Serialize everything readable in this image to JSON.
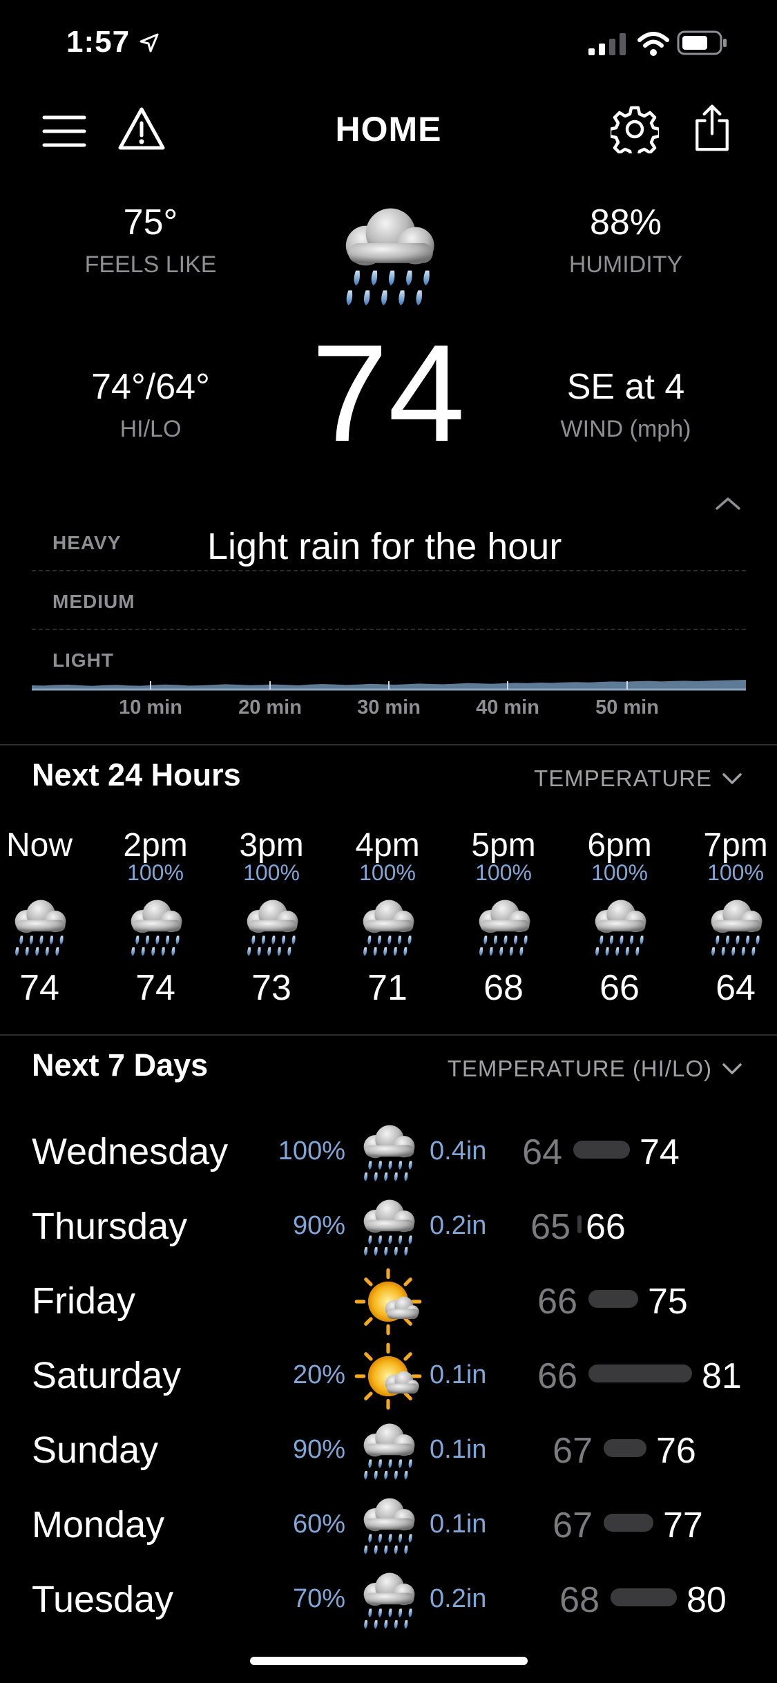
{
  "status_bar": {
    "time": "1:57"
  },
  "header": {
    "title": "HOME"
  },
  "current": {
    "feels_like_value": "75°",
    "feels_like_label": "FEELS LIKE",
    "humidity_value": "88%",
    "humidity_label": "HUMIDITY",
    "hilo_value": "74°/64°",
    "hilo_label": "HI/LO",
    "wind_value": "SE at 4",
    "wind_label": "WIND (mph)",
    "temperature": "74"
  },
  "precip": {
    "summary": "Light rain for the hour",
    "levels": [
      "HEAVY",
      "MEDIUM",
      "LIGHT"
    ],
    "ticks": [
      "10 min",
      "20 min",
      "30 min",
      "40 min",
      "50 min"
    ],
    "intensity": [
      0.3,
      0.28,
      0.33,
      0.35,
      0.3,
      0.26,
      0.31,
      0.34,
      0.29,
      0.27,
      0.32,
      0.36,
      0.33,
      0.28,
      0.3,
      0.34,
      0.38,
      0.35,
      0.31,
      0.33,
      0.37,
      0.34,
      0.3,
      0.36,
      0.4,
      0.37,
      0.33,
      0.36,
      0.41,
      0.38,
      0.35,
      0.39,
      0.43,
      0.4,
      0.38,
      0.42,
      0.46,
      0.44,
      0.41,
      0.45,
      0.48,
      0.46,
      0.5,
      0.48,
      0.52,
      0.54,
      0.51,
      0.55,
      0.58,
      0.56,
      0.6,
      0.62,
      0.58,
      0.61,
      0.63,
      0.6,
      0.64,
      0.66,
      0.68,
      0.7
    ]
  },
  "hourly": {
    "title": "Next 24 Hours",
    "selector": "TEMPERATURE",
    "items": [
      {
        "time": "Now",
        "pct": "",
        "temp": "74",
        "icon": "rain-cloud-icon"
      },
      {
        "time": "2pm",
        "pct": "100%",
        "temp": "74",
        "icon": "rain-cloud-icon"
      },
      {
        "time": "3pm",
        "pct": "100%",
        "temp": "73",
        "icon": "rain-cloud-icon"
      },
      {
        "time": "4pm",
        "pct": "100%",
        "temp": "71",
        "icon": "rain-cloud-icon"
      },
      {
        "time": "5pm",
        "pct": "100%",
        "temp": "68",
        "icon": "rain-cloud-icon"
      },
      {
        "time": "6pm",
        "pct": "100%",
        "temp": "66",
        "icon": "rain-cloud-icon"
      },
      {
        "time": "7pm",
        "pct": "100%",
        "temp": "64",
        "icon": "rain-cloud-icon"
      }
    ]
  },
  "daily": {
    "title": "Next 7 Days",
    "selector": "TEMPERATURE (HI/LO)",
    "days": [
      {
        "name": "Wednesday",
        "pct": "100%",
        "icon": "rain-cloud-icon",
        "amount": "0.4in",
        "lo": "64",
        "hi": "74"
      },
      {
        "name": "Thursday",
        "pct": "90%",
        "icon": "rain-cloud-icon",
        "amount": "0.2in",
        "lo": "65",
        "hi": "66"
      },
      {
        "name": "Friday",
        "pct": "",
        "icon": "partly-sunny-icon",
        "amount": "",
        "lo": "66",
        "hi": "75"
      },
      {
        "name": "Saturday",
        "pct": "20%",
        "icon": "partly-sunny-icon",
        "amount": "0.1in",
        "lo": "66",
        "hi": "81"
      },
      {
        "name": "Sunday",
        "pct": "90%",
        "icon": "rain-cloud-icon",
        "amount": "0.1in",
        "lo": "67",
        "hi": "76"
      },
      {
        "name": "Monday",
        "pct": "60%",
        "icon": "rain-cloud-icon",
        "amount": "0.1in",
        "lo": "67",
        "hi": "77"
      },
      {
        "name": "Tuesday",
        "pct": "70%",
        "icon": "rain-cloud-icon",
        "amount": "0.2in",
        "lo": "68",
        "hi": "80"
      }
    ]
  },
  "colors": {
    "accent_blue": "#7fa7d8",
    "precip_fill": "#5d7a97",
    "muted": "#8e8e93"
  }
}
